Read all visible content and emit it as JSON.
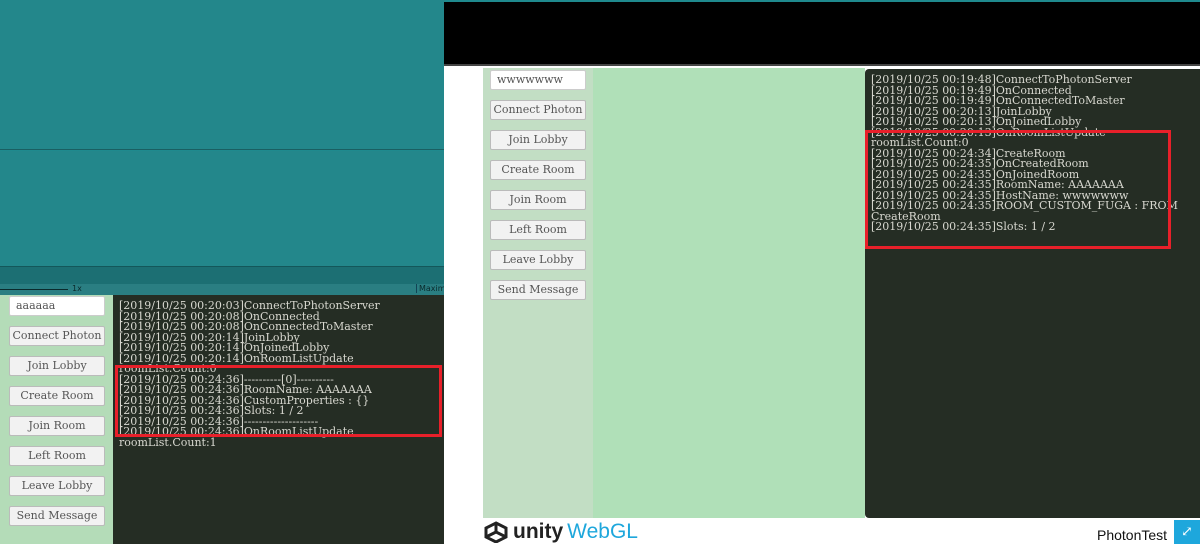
{
  "editor": {
    "zoom_label": "1x",
    "maximize_label": "Maxim"
  },
  "left_game": {
    "name_input": "aaaaaa",
    "buttons": [
      "Connect Photon",
      "Join Lobby",
      "Create Room",
      "Join Room",
      "Left Room",
      "Leave Lobby",
      "Send Message"
    ],
    "log": [
      "[2019/10/25 00:20:03]ConnectToPhotonServer",
      "[2019/10/25 00:20:08]OnConnected",
      "[2019/10/25 00:20:08]OnConnectedToMaster",
      "[2019/10/25 00:20:14]JoinLobby",
      "[2019/10/25 00:20:14]OnJoinedLobby",
      "[2019/10/25 00:20:14]OnRoomListUpdate roomList.Count:0",
      "[2019/10/25 00:24:36]----------[0]----------",
      "[2019/10/25 00:24:36]RoomName: AAAAAAA",
      "[2019/10/25 00:24:36]CustomProperties : {}",
      "[2019/10/25 00:24:36]Slots: 1 / 2",
      "[2019/10/25 00:24:36]--------------------",
      "[2019/10/25 00:24:36]OnRoomListUpdate roomList.Count:1"
    ]
  },
  "right_game": {
    "name_input": "wwwwwww",
    "buttons": [
      "Connect Photon",
      "Join Lobby",
      "Create Room",
      "Join Room",
      "Left Room",
      "Leave Lobby",
      "Send Message"
    ],
    "log": [
      "[2019/10/25 00:19:48]ConnectToPhotonServer",
      "[2019/10/25 00:19:49]OnConnected",
      "[2019/10/25 00:19:49]OnConnectedToMaster",
      "[2019/10/25 00:20:13]JoinLobby",
      "[2019/10/25 00:20:13]OnJoinedLobby",
      "[2019/10/25 00:20:13]OnRoomListUpdate roomList.Count:0",
      "[2019/10/25 00:24:34]CreateRoom",
      "[2019/10/25 00:24:35]OnCreatedRoom",
      "[2019/10/25 00:24:35]OnJoinedRoom",
      "[2019/10/25 00:24:35]RoomName: AAAAAAA",
      "[2019/10/25 00:24:35]HostName: wwwwwww",
      "[2019/10/25 00:24:35]ROOM_CUSTOM_FUGA : FROM CreateRoom",
      "[2019/10/25 00:24:35]Slots: 1 / 2"
    ]
  },
  "footer": {
    "logo_unity": "unity",
    "logo_webgl": "WebGL",
    "title": "PhotonTest",
    "fullscreen_icon": "expand-icon"
  },
  "colors": {
    "highlight": "#e8202a",
    "log_bg": "#252d24",
    "panel_green": "#b0e0b8",
    "accent": "#1ea7dc"
  }
}
